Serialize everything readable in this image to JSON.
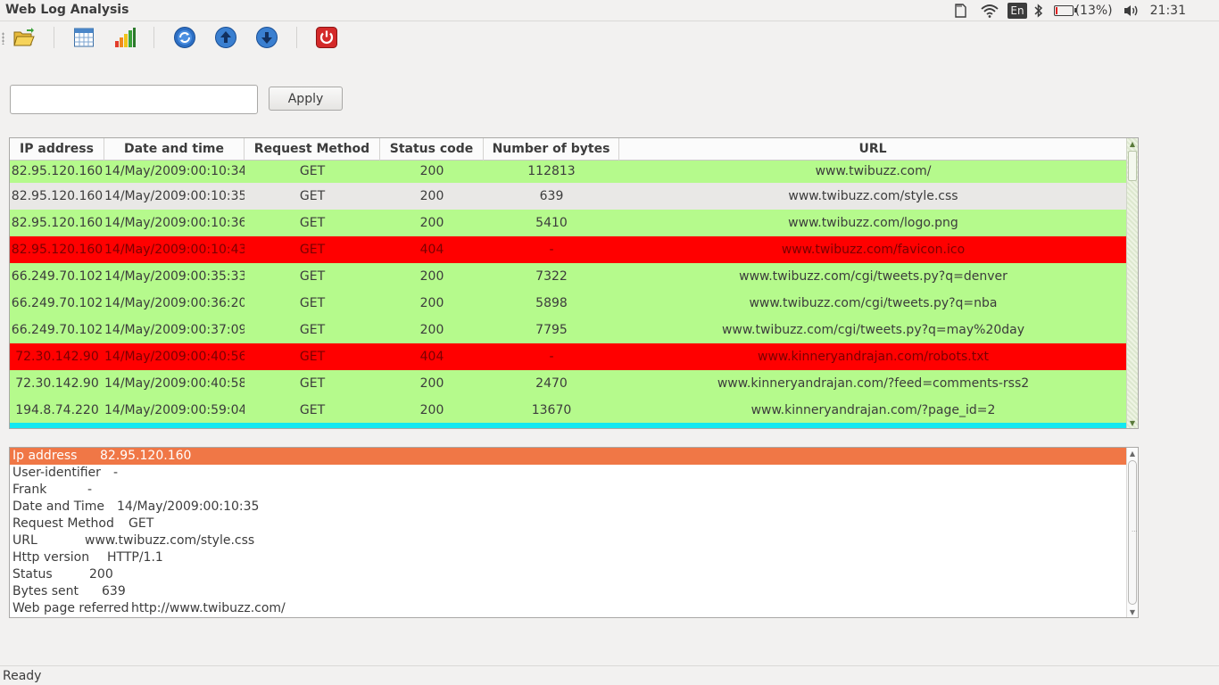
{
  "window": {
    "title": "Web Log Analysis"
  },
  "indicators": {
    "keyboard_layout": "En",
    "battery_text": "(13%)",
    "battery_level_percent": 13,
    "clock": "21:31"
  },
  "toolbar": {
    "buttons": [
      {
        "name": "open-file-button",
        "icon": "folder-open-icon"
      },
      {
        "name": "table-view-button",
        "icon": "calendar-table-icon"
      },
      {
        "name": "statistics-button",
        "icon": "bar-chart-icon"
      },
      {
        "name": "refresh-button",
        "icon": "refresh-icon"
      },
      {
        "name": "move-up-button",
        "icon": "arrow-up-icon"
      },
      {
        "name": "move-down-button",
        "icon": "arrow-down-icon"
      },
      {
        "name": "quit-button",
        "icon": "power-icon"
      }
    ]
  },
  "filter": {
    "value": "",
    "apply_label": "Apply"
  },
  "table": {
    "columns": [
      "IP address",
      "Date and time",
      "Request Method",
      "Status code",
      "Number of bytes",
      "URL"
    ],
    "rows": [
      {
        "state": "ok",
        "cells": [
          "82.95.120.160",
          "14/May/2009:00:10:34",
          "GET",
          "200",
          "112813",
          "www.twibuzz.com/"
        ]
      },
      {
        "state": "sel",
        "cells": [
          "82.95.120.160",
          "14/May/2009:00:10:35",
          "GET",
          "200",
          "639",
          "www.twibuzz.com/style.css"
        ]
      },
      {
        "state": "ok",
        "cells": [
          "82.95.120.160",
          "14/May/2009:00:10:36",
          "GET",
          "200",
          "5410",
          "www.twibuzz.com/logo.png"
        ]
      },
      {
        "state": "err",
        "cells": [
          "82.95.120.160",
          "14/May/2009:00:10:43",
          "GET",
          "404",
          "-",
          "www.twibuzz.com/favicon.ico"
        ]
      },
      {
        "state": "ok",
        "cells": [
          "66.249.70.102",
          "14/May/2009:00:35:33",
          "GET",
          "200",
          "7322",
          "www.twibuzz.com/cgi/tweets.py?q=denver"
        ]
      },
      {
        "state": "ok",
        "cells": [
          "66.249.70.102",
          "14/May/2009:00:36:20",
          "GET",
          "200",
          "5898",
          "www.twibuzz.com/cgi/tweets.py?q=nba"
        ]
      },
      {
        "state": "ok",
        "cells": [
          "66.249.70.102",
          "14/May/2009:00:37:09",
          "GET",
          "200",
          "7795",
          "www.twibuzz.com/cgi/tweets.py?q=may%20day"
        ]
      },
      {
        "state": "err",
        "cells": [
          "72.30.142.90",
          "14/May/2009:00:40:56",
          "GET",
          "404",
          "-",
          "www.kinneryandrajan.com/robots.txt"
        ]
      },
      {
        "state": "ok",
        "cells": [
          "72.30.142.90",
          "14/May/2009:00:40:58",
          "GET",
          "200",
          "2470",
          "www.kinneryandrajan.com/?feed=comments-rss2"
        ]
      },
      {
        "state": "ok",
        "cells": [
          "194.8.74.220",
          "14/May/2009:00:59:04",
          "GET",
          "200",
          "13670",
          "www.kinneryandrajan.com/?page_id=2"
        ]
      }
    ]
  },
  "details": {
    "rows": [
      {
        "label": "Ip address",
        "value": "82.95.120.160",
        "selected": true
      },
      {
        "label": "User-identifier",
        "value": "-"
      },
      {
        "label": "Frank",
        "value": "-"
      },
      {
        "label": "Date and Time",
        "value": "14/May/2009:00:10:35"
      },
      {
        "label": "Request Method",
        "value": "GET"
      },
      {
        "label": "URL",
        "value": "www.twibuzz.com/style.css"
      },
      {
        "label": "Http version",
        "value": "HTTP/1.1"
      },
      {
        "label": "Status",
        "value": "200"
      },
      {
        "label": "Bytes sent",
        "value": "639"
      },
      {
        "label": "Web page referred",
        "value": "http://www.twibuzz.com/"
      }
    ]
  },
  "status": {
    "text": "Ready"
  }
}
